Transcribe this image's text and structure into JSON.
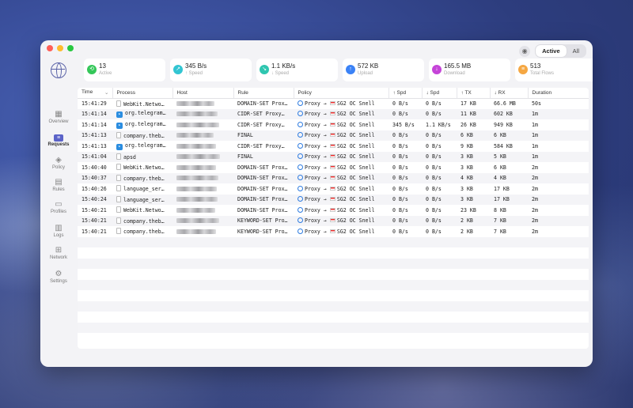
{
  "toolbar": {
    "filter_active": "Active",
    "filter_all": "All",
    "eye_icon": "eye-icon"
  },
  "sidebar": {
    "items": [
      {
        "label": "Overview",
        "icon": "grid-icon",
        "glyph": "▦"
      },
      {
        "label": "Requests",
        "icon": "requests-icon",
        "glyph": "≡"
      },
      {
        "label": "Policy",
        "icon": "layers-icon",
        "glyph": "◈"
      },
      {
        "label": "Rules",
        "icon": "rules-icon",
        "glyph": "▤"
      },
      {
        "label": "Profiles",
        "icon": "folder-icon",
        "glyph": "▭"
      },
      {
        "label": "Logs",
        "icon": "logs-icon",
        "glyph": "▥"
      },
      {
        "label": "Network",
        "icon": "network-icon",
        "glyph": "⊞"
      },
      {
        "label": "Settings",
        "icon": "gear-icon",
        "glyph": "⚙"
      }
    ]
  },
  "stats": [
    {
      "value": "13",
      "label": "Active",
      "color": "#34c759",
      "glyph": "⟲"
    },
    {
      "value": "345 B/s",
      "label": "↑ Speed",
      "color": "#32c5d2",
      "glyph": "↗"
    },
    {
      "value": "1.1 KB/s",
      "label": "↓ Speed",
      "color": "#2fc6b0",
      "glyph": "↘"
    },
    {
      "value": "572 KB",
      "label": "Upload",
      "color": "#3b82f6",
      "glyph": "↑"
    },
    {
      "value": "165.5 MB",
      "label": "Download",
      "color": "#c544d8",
      "glyph": "↓"
    },
    {
      "value": "513",
      "label": "Total Flows",
      "color": "#f5a742",
      "glyph": "≡"
    }
  ],
  "table": {
    "columns": [
      "Time",
      "Process",
      "Host",
      "Rule",
      "Policy",
      "↑ Spd",
      "↓ Spd",
      "↑ TX",
      "↓ RX",
      "Duration"
    ],
    "sort_indicator": "⌄",
    "policy_arrow": "→",
    "rows": [
      {
        "time": "15:41:29",
        "process": "WebKit.Netwo…",
        "pic": "doc",
        "rule": "DOMAIN-SET Prox…",
        "proxy": "Proxy",
        "node": "SG2 OC Snell",
        "up": "0 B/s",
        "down": "0 B/s",
        "tx": "17 KB",
        "rx": "66.6 MB",
        "dur": "50s"
      },
      {
        "time": "15:41:14",
        "process": "org.telegram…",
        "pic": "tg",
        "rule": "CIDR-SET Proxy…",
        "proxy": "Proxy",
        "node": "SG2 OC Snell",
        "up": "0 B/s",
        "down": "0 B/s",
        "tx": "11 KB",
        "rx": "602 KB",
        "dur": "1m"
      },
      {
        "time": "15:41:14",
        "process": "org.telegram…",
        "pic": "tg",
        "rule": "CIDR-SET Proxy…",
        "proxy": "Proxy",
        "node": "SG2 OC Snell",
        "up": "345 B/s",
        "down": "1.1 KB/s",
        "tx": "26 KB",
        "rx": "949 KB",
        "dur": "1m"
      },
      {
        "time": "15:41:13",
        "process": "company.theb…",
        "pic": "doc",
        "rule": "FINAL",
        "proxy": "Proxy",
        "node": "SG2 OC Snell",
        "up": "0 B/s",
        "down": "0 B/s",
        "tx": "6 KB",
        "rx": "6 KB",
        "dur": "1m"
      },
      {
        "time": "15:41:13",
        "process": "org.telegram…",
        "pic": "tg",
        "rule": "CIDR-SET Proxy…",
        "proxy": "Proxy",
        "node": "SG2 OC Snell",
        "up": "0 B/s",
        "down": "0 B/s",
        "tx": "9 KB",
        "rx": "584 KB",
        "dur": "1m"
      },
      {
        "time": "15:41:04",
        "process": "apsd",
        "pic": "doc",
        "rule": "FINAL",
        "proxy": "Proxy",
        "node": "SG2 OC Snell",
        "up": "0 B/s",
        "down": "0 B/s",
        "tx": "3 KB",
        "rx": "5 KB",
        "dur": "1m"
      },
      {
        "time": "15:40:40",
        "process": "WebKit.Netwo…",
        "pic": "doc",
        "rule": "DOMAIN-SET Prox…",
        "proxy": "Proxy",
        "node": "SG2 OC Snell",
        "up": "0 B/s",
        "down": "0 B/s",
        "tx": "3 KB",
        "rx": "6 KB",
        "dur": "2m"
      },
      {
        "time": "15:40:37",
        "process": "company.theb…",
        "pic": "doc",
        "rule": "DOMAIN-SET Prox…",
        "proxy": "Proxy",
        "node": "SG2 OC Snell",
        "up": "0 B/s",
        "down": "0 B/s",
        "tx": "4 KB",
        "rx": "4 KB",
        "dur": "2m"
      },
      {
        "time": "15:40:26",
        "process": "language_ser…",
        "pic": "doc",
        "rule": "DOMAIN-SET Prox…",
        "proxy": "Proxy",
        "node": "SG2 OC Snell",
        "up": "0 B/s",
        "down": "0 B/s",
        "tx": "3 KB",
        "rx": "17 KB",
        "dur": "2m"
      },
      {
        "time": "15:40:24",
        "process": "language_ser…",
        "pic": "doc",
        "rule": "DOMAIN-SET Prox…",
        "proxy": "Proxy",
        "node": "SG2 OC Snell",
        "up": "0 B/s",
        "down": "0 B/s",
        "tx": "3 KB",
        "rx": "17 KB",
        "dur": "2m"
      },
      {
        "time": "15:40:21",
        "process": "WebKit.Netwo…",
        "pic": "doc",
        "rule": "DOMAIN-SET Prox…",
        "proxy": "Proxy",
        "node": "SG2 OC Snell",
        "up": "0 B/s",
        "down": "0 B/s",
        "tx": "23 KB",
        "rx": "8 KB",
        "dur": "2m"
      },
      {
        "time": "15:40:21",
        "process": "company.theb…",
        "pic": "doc",
        "rule": "KEYWORD-SET Pro…",
        "proxy": "Proxy",
        "node": "SG2 OC Snell",
        "up": "0 B/s",
        "down": "0 B/s",
        "tx": "2 KB",
        "rx": "7 KB",
        "dur": "2m"
      },
      {
        "time": "15:40:21",
        "process": "company.theb…",
        "pic": "doc",
        "rule": "KEYWORD-SET Pro…",
        "proxy": "Proxy",
        "node": "SG2 OC Snell",
        "up": "0 B/s",
        "down": "0 B/s",
        "tx": "2 KB",
        "rx": "7 KB",
        "dur": "2m"
      }
    ]
  }
}
